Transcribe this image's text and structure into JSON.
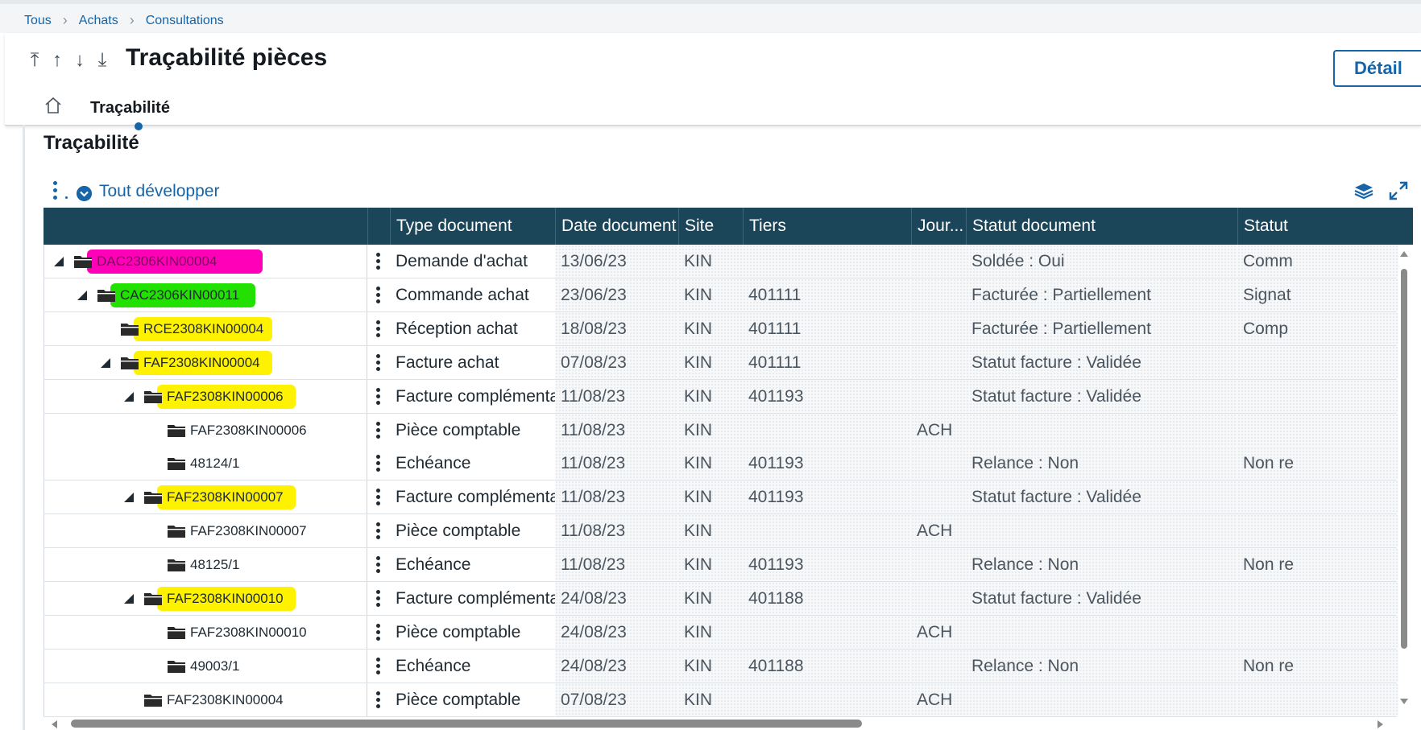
{
  "breadcrumb": [
    "Tous",
    "Achats",
    "Consultations"
  ],
  "page": {
    "title": "Traçabilité pièces",
    "detail_button": "Détail",
    "tab": "Traçabilité"
  },
  "section": {
    "title": "Traçabilité",
    "expand_all": "Tout développer"
  },
  "columns": [
    "Type document",
    "Date document",
    "Site",
    "Tiers",
    "Jour...",
    "Statut document",
    "Statut"
  ],
  "rows": [
    {
      "code": "DAC2306KIN00004",
      "type": "Demande d'achat",
      "date": "13/06/23",
      "site": "KIN",
      "tiers": "",
      "journal": "",
      "statut": "Soldée : Oui",
      "statut2": "Comm",
      "level": 0,
      "expanded": true,
      "highlight": "pink"
    },
    {
      "code": "CAC2306KIN00011",
      "type": "Commande achat",
      "date": "23/06/23",
      "site": "KIN",
      "tiers": "401111",
      "journal": "",
      "statut": "Facturée : Partiellement",
      "statut2": "Signat",
      "level": 1,
      "expanded": true,
      "highlight": "green"
    },
    {
      "code": "RCE2308KIN00004",
      "type": "Réception achat",
      "date": "18/08/23",
      "site": "KIN",
      "tiers": "401111",
      "journal": "",
      "statut": "Facturée : Partiellement",
      "statut2": "Comp",
      "level": 2,
      "expanded": false,
      "highlight": "yellow"
    },
    {
      "code": "FAF2308KIN00004",
      "type": "Facture achat",
      "date": "07/08/23",
      "site": "KIN",
      "tiers": "401111",
      "journal": "",
      "statut": "Statut facture : Validée",
      "statut2": "",
      "level": 2,
      "expanded": true,
      "highlight": "yellow"
    },
    {
      "code": "FAF2308KIN00006",
      "type": "Facture complémentai",
      "date": "11/08/23",
      "site": "KIN",
      "tiers": "401193",
      "journal": "",
      "statut": "Statut facture : Validée",
      "statut2": "",
      "level": 3,
      "expanded": true,
      "highlight": "yellow"
    },
    {
      "code": "FAF2308KIN00006",
      "type": "Pièce comptable",
      "date": "11/08/23",
      "site": "KIN",
      "tiers": "",
      "journal": "ACH",
      "statut": "",
      "statut2": "",
      "level": 4,
      "expanded": false,
      "highlight": ""
    },
    {
      "code": "48124/1",
      "type": "Echéance",
      "date": "11/08/23",
      "site": "KIN",
      "tiers": "401193",
      "journal": "",
      "statut": "Relance : Non",
      "statut2": "Non re",
      "level": 4,
      "expanded": false,
      "highlight": ""
    },
    {
      "code": "FAF2308KIN00007",
      "type": "Facture complémentai",
      "date": "11/08/23",
      "site": "KIN",
      "tiers": "401193",
      "journal": "",
      "statut": "Statut facture : Validée",
      "statut2": "",
      "level": 3,
      "expanded": true,
      "highlight": "yellow"
    },
    {
      "code": "FAF2308KIN00007",
      "type": "Pièce comptable",
      "date": "11/08/23",
      "site": "KIN",
      "tiers": "",
      "journal": "ACH",
      "statut": "",
      "statut2": "",
      "level": 4,
      "expanded": false,
      "highlight": ""
    },
    {
      "code": "48125/1",
      "type": "Echéance",
      "date": "11/08/23",
      "site": "KIN",
      "tiers": "401193",
      "journal": "",
      "statut": "Relance : Non",
      "statut2": "Non re",
      "level": 4,
      "expanded": false,
      "highlight": ""
    },
    {
      "code": "FAF2308KIN00010",
      "type": "Facture complémentai",
      "date": "24/08/23",
      "site": "KIN",
      "tiers": "401188",
      "journal": "",
      "statut": "Statut facture : Validée",
      "statut2": "",
      "level": 3,
      "expanded": true,
      "highlight": "yellow"
    },
    {
      "code": "FAF2308KIN00010",
      "type": "Pièce comptable",
      "date": "24/08/23",
      "site": "KIN",
      "tiers": "",
      "journal": "ACH",
      "statut": "",
      "statut2": "",
      "level": 4,
      "expanded": false,
      "highlight": ""
    },
    {
      "code": "49003/1",
      "type": "Echéance",
      "date": "24/08/23",
      "site": "KIN",
      "tiers": "401188",
      "journal": "",
      "statut": "Relance : Non",
      "statut2": "Non re",
      "level": 4,
      "expanded": false,
      "highlight": ""
    },
    {
      "code": "FAF2308KIN00004",
      "type": "Pièce comptable",
      "date": "07/08/23",
      "site": "KIN",
      "tiers": "",
      "journal": "ACH",
      "statut": "",
      "statut2": "",
      "level": 3,
      "expanded": false,
      "highlight": ""
    }
  ],
  "colors": {
    "header_bg": "#1b4558",
    "accent": "#1565a8",
    "highlight_pink": "#ff00b8",
    "highlight_green": "#22e000",
    "highlight_yellow": "#fff200"
  }
}
